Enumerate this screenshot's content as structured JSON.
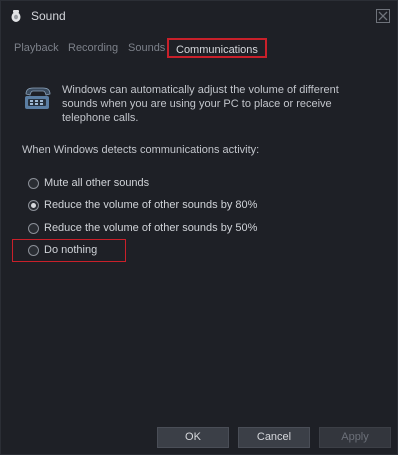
{
  "window": {
    "title": "Sound",
    "icon": "speaker-icon",
    "close_icon": "close-icon"
  },
  "tabs": [
    {
      "label": "Playback",
      "active": false
    },
    {
      "label": "Recording",
      "active": false
    },
    {
      "label": "Sounds",
      "active": false
    },
    {
      "label": "Communications",
      "active": true
    }
  ],
  "main": {
    "icon": "telephone-icon",
    "description_lines": [
      "Windows can automatically adjust the volume of different",
      "sounds when you are using your PC to place or receive",
      "telephone calls."
    ],
    "section_label": "When Windows detects communications activity:",
    "options": [
      {
        "label": "Mute all other sounds",
        "checked": false
      },
      {
        "label": "Reduce the volume of other sounds by 80%",
        "checked": true
      },
      {
        "label": "Reduce the volume of other sounds by 50%",
        "checked": false
      },
      {
        "label": "Do nothing",
        "checked": false
      }
    ]
  },
  "footer": {
    "ok_label": "OK",
    "cancel_label": "Cancel",
    "apply_label": "Apply"
  },
  "colors": {
    "highlight": "#c9202a",
    "background": "#1e2026"
  }
}
